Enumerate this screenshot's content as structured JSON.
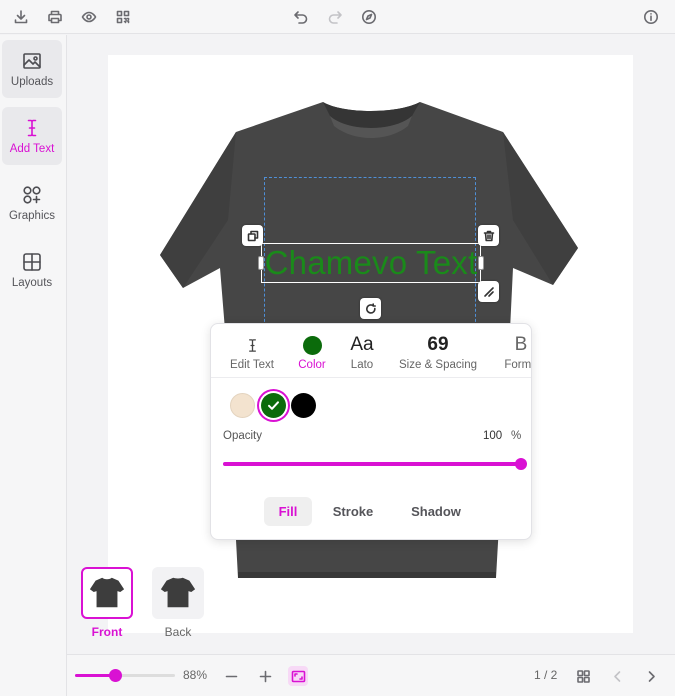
{
  "toolbar": {
    "icons": [
      "download-icon",
      "print-icon",
      "eye-icon",
      "qr-code-icon",
      "undo-icon",
      "redo-icon",
      "compass-icon",
      "info-icon"
    ]
  },
  "sidebar": {
    "items": [
      {
        "label": "Uploads",
        "icon": "image-icon"
      },
      {
        "label": "Add Text",
        "icon": "text-cursor-icon"
      },
      {
        "label": "Graphics",
        "icon": "shapes-icon"
      },
      {
        "label": "Layouts",
        "icon": "grid-icon"
      }
    ]
  },
  "design": {
    "text": "Chamevo Text",
    "text_color": "#1a8a1a"
  },
  "text_panel": {
    "tabs": [
      {
        "label": "Edit Text",
        "icon": "text-cursor-icon"
      },
      {
        "label": "Color",
        "icon": "color-swatch-icon"
      },
      {
        "label": "Lato",
        "glyph": "Aa"
      },
      {
        "label": "Size & Spacing",
        "glyph": "69"
      },
      {
        "label": "Forma",
        "glyph": "B"
      }
    ],
    "swatches": [
      "#f3e3cf",
      "#0b6b0b",
      "#000000"
    ],
    "selected_swatch": "#0b6b0b",
    "opacity_label": "Opacity",
    "opacity_value": "100",
    "opacity_unit": "%",
    "opacity": 1.0,
    "modes": [
      "Fill",
      "Stroke",
      "Shadow"
    ],
    "active_mode": "Fill"
  },
  "views": [
    {
      "label": "Front",
      "active": true
    },
    {
      "label": "Back",
      "active": false
    }
  ],
  "bottom": {
    "zoom_label": "88%",
    "zoom_level": 0.4,
    "page_indicator": "1 / 2"
  },
  "colors": {
    "accent": "#d911d3",
    "shirt": "#454545"
  }
}
